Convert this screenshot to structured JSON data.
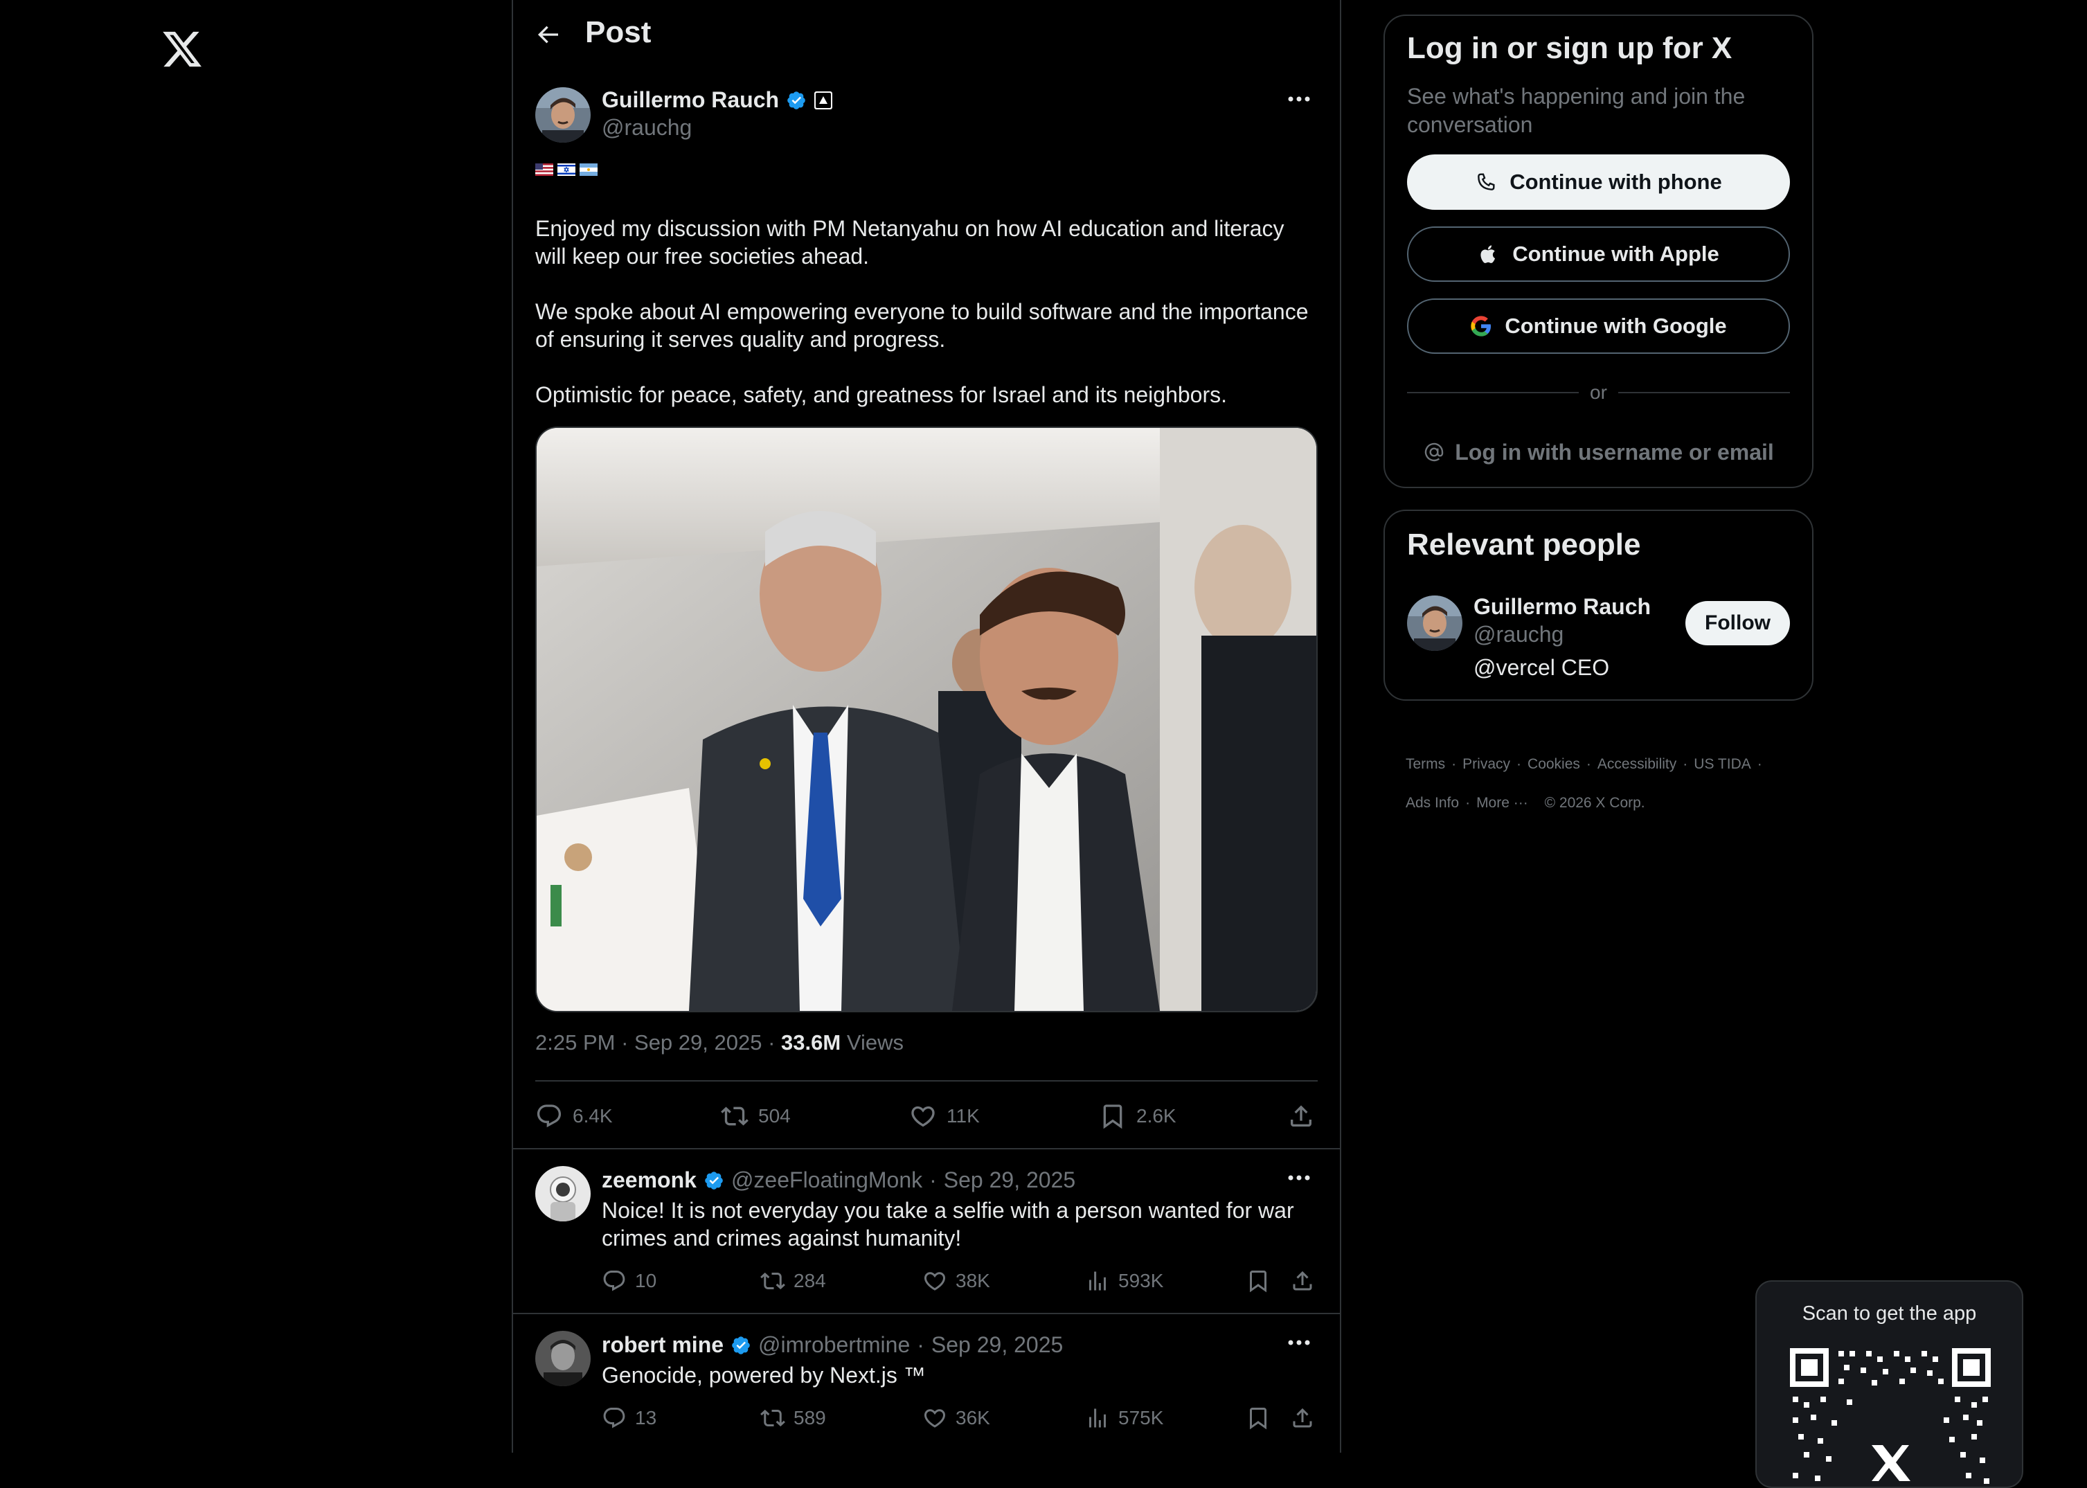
{
  "header": {
    "title": "Post"
  },
  "post": {
    "author_name": "Guillermo Rauch",
    "author_handle": "@rauchg",
    "flags": [
      "US flag",
      "Israel flag",
      "Argentina flag"
    ],
    "paragraphs": [
      "Enjoyed my discussion with PM Netanyahu on how AI education and literacy will keep our free societies ahead.",
      "We spoke about AI empowering everyone to build software and the importance of ensuring it serves quality and progress.",
      "Optimistic for peace, safety, and greatness for Israel and its neighbors."
    ],
    "time": "2:25 PM",
    "date": "Sep 29, 2025",
    "views_count": "33.6M",
    "views_label": "Views",
    "stats": {
      "replies": "6.4K",
      "reposts": "504",
      "likes": "11K",
      "bookmarks": "2.6K"
    }
  },
  "replies": [
    {
      "name": "zeemonk",
      "handle": "@zeeFloatingMonk",
      "date": "Sep 29, 2025",
      "text": "Noice! It is not everyday you take a selfie with a person wanted for war crimes and crimes against humanity!",
      "replies": "10",
      "reposts": "284",
      "likes": "38K",
      "views": "593K"
    },
    {
      "name": "robert mine",
      "handle": "@imrobertmine",
      "date": "Sep 29, 2025",
      "text": "Genocide, powered by Next.js ™",
      "replies": "13",
      "reposts": "589",
      "likes": "36K",
      "views": "575K"
    }
  ],
  "login": {
    "title": "Log in or sign up for X",
    "subtitle": "See what's happening and join the conversation",
    "phone": "Continue with phone",
    "apple": "Continue with Apple",
    "google": "Continue with Google",
    "or": "or",
    "username": "Log in with username or email"
  },
  "people": {
    "title": "Relevant people",
    "name": "Guillermo Rauch",
    "handle": "@rauchg",
    "bio": "@vercel CEO",
    "follow": "Follow"
  },
  "footer": {
    "terms": "Terms",
    "privacy": "Privacy",
    "cookies": "Cookies",
    "accessibility": "Accessibility",
    "tida": "US TIDA",
    "ads": "Ads Info",
    "more": "More ···",
    "copyright": "© 2026 X Corp."
  },
  "qr": {
    "label": "Scan to get the app"
  },
  "colors": {
    "verified": "#1d9bf0",
    "background": "#000000",
    "border": "#2f3336",
    "muted": "#71767b"
  }
}
